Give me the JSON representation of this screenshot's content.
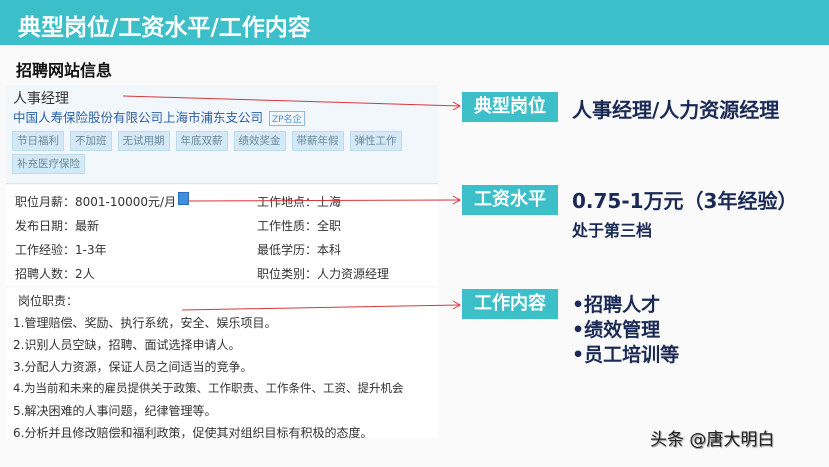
{
  "title": "典型岗位/工资水平/工作内容",
  "subtitle": "招聘网站信息",
  "job": {
    "title": "人事经理",
    "company": "中国人寿保险股份有限公司上海市浦东支公司",
    "badge": "ZP名企",
    "tags": [
      "节日福利",
      "不加班",
      "无试用期",
      "年底双薪",
      "绩效奖金",
      "带薪年假",
      "弹性工作",
      "补充医疗保险"
    ]
  },
  "details": [
    {
      "label": "职位月薪：",
      "value": "8001-10000元/月"
    },
    {
      "label": "工作地点：",
      "value": "上海"
    },
    {
      "label": "发布日期：",
      "value": "最新"
    },
    {
      "label": "工作性质：",
      "value": "全职"
    },
    {
      "label": "工作经验：",
      "value": "1-3年"
    },
    {
      "label": "最低学历：",
      "value": "本科"
    },
    {
      "label": "招聘人数：",
      "value": "2人"
    },
    {
      "label": "职位类别：",
      "value": "人力资源经理"
    }
  ],
  "duties": {
    "heading": "岗位职责：",
    "items": [
      "1.管理赔偿、奖励、执行系统，安全、娱乐项目。",
      "2.识别人员空缺，招聘、面试选择申请人。",
      "3.分配人力资源，保证人员之间适当的竞争。",
      "4.为当前和未来的雇员提供关于政策、工作职责、工作条件、工资、提升机会",
      "5.解决困难的人事问题，纪律管理等。",
      "6.分析并且修改赔偿和福利政策，促使其对组织目标有积极的态度。"
    ]
  },
  "summary": {
    "position": {
      "label": "典型岗位",
      "value": "人事经理/人力资源经理"
    },
    "salary": {
      "label": "工资水平",
      "value": "0.75-1万元（3年经验）",
      "note": "处于第三档"
    },
    "content": {
      "label": "工作内容",
      "items": [
        "•招聘人才",
        "•绩效管理",
        "•员工培训等"
      ]
    }
  },
  "watermark": "头条 @唐大明白",
  "colors": {
    "accent": "#3cbfc9",
    "text_dark": "#1b2a55",
    "arrow": "#d9363e"
  }
}
